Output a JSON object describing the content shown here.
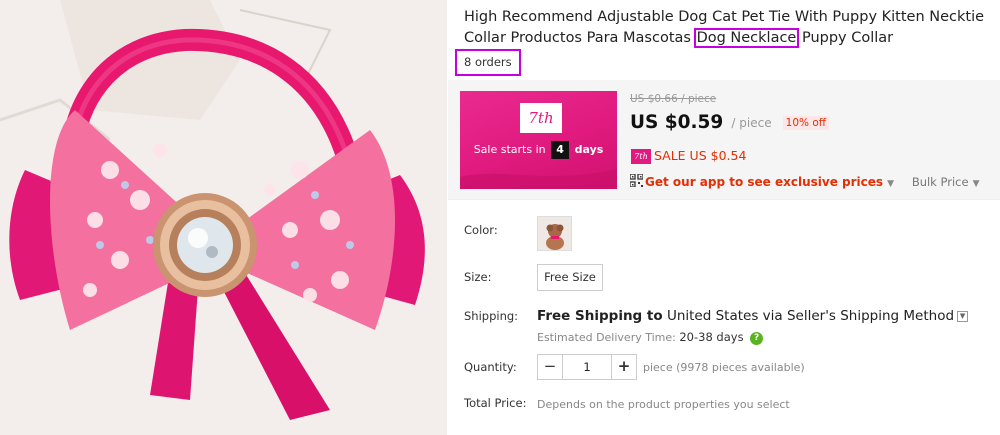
{
  "product": {
    "title_part1": "High Recommend Adjustable Dog Cat Pet Tie With Puppy Kitten Necktie Collar Productos Para Mascotas ",
    "title_highlight": "Dog Necklace",
    "title_part2": " Puppy Collar",
    "orders": "8 orders"
  },
  "promo": {
    "badge": "7th",
    "starts_text": "Sale starts in",
    "days_number": "4",
    "days_word": "days"
  },
  "price": {
    "original": "US $0.66 / piece",
    "current": "US $0.59",
    "unit": "/ piece",
    "discount": "10% off",
    "sale_badge": "7th",
    "sale_price": "SALE US $0.54",
    "app_link": "Get our app to see exclusive prices",
    "bulk_price": "Bulk Price"
  },
  "options": {
    "color_label": "Color:",
    "size_label": "Size:",
    "size_value": "Free Size",
    "shipping_label": "Shipping:",
    "shipping_free": "Free Shipping to",
    "shipping_dest": "United States via Seller's Shipping Method",
    "est_label": "Estimated Delivery Time:",
    "est_days": "20-38 days",
    "help": "?",
    "quantity_label": "Quantity:",
    "quantity_minus": "−",
    "quantity_value": "1",
    "quantity_plus": "+",
    "quantity_available": "piece (9978 pieces available)",
    "total_label": "Total Price:",
    "total_value": "Depends on the product properties you select"
  },
  "colors": {
    "highlight": "#c600e0",
    "promo_pink": "#e01a7e",
    "sale_red": "#e62e04",
    "help_green": "#5ab31f"
  }
}
